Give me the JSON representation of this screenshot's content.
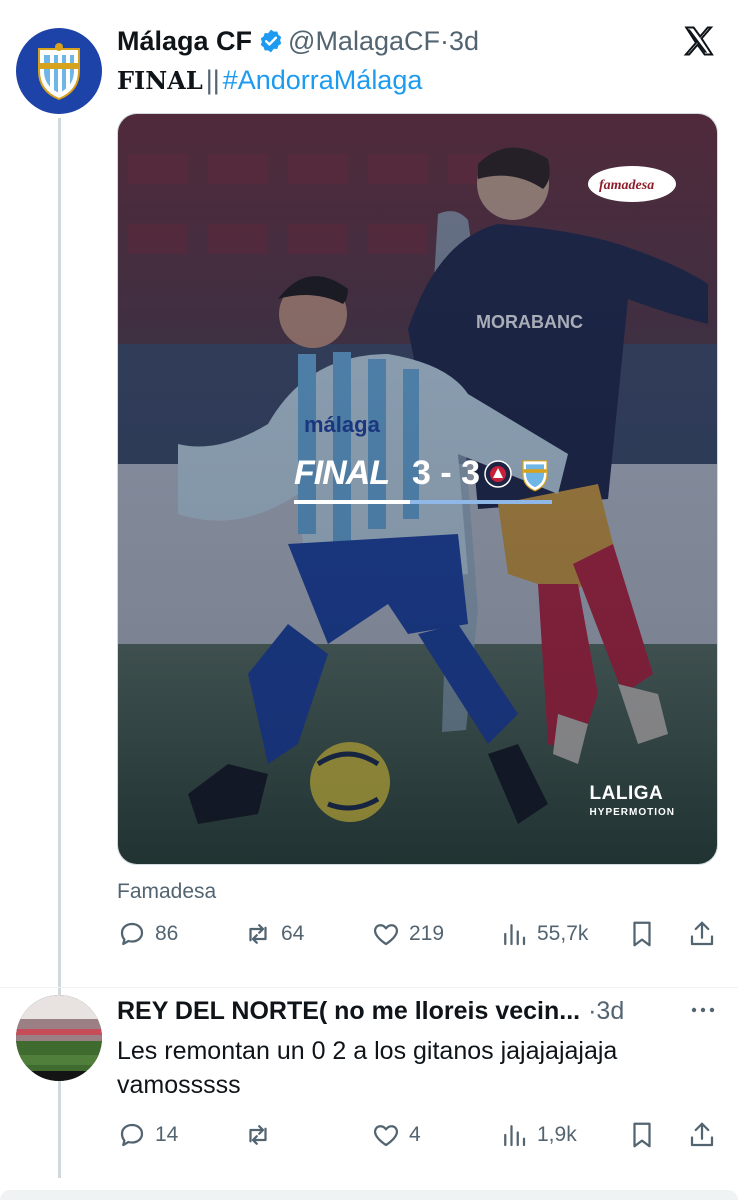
{
  "tweet": {
    "name": "Málaga CF",
    "handle": "@MalagaCF",
    "dot": "·",
    "time": "3d",
    "text_bold": "FINAL",
    "text_sep": "||",
    "hashtag": "#AndorraMálaga",
    "image": {
      "score_label": "FINAL",
      "score": "3 - 3",
      "sponsor_logo": "famadesa",
      "league_line1": "LALIGA",
      "league_line2": "HYPERMOTION"
    },
    "attribution": "Famadesa",
    "actions": {
      "replies": "86",
      "reposts": "64",
      "likes": "219",
      "views": "55,7k"
    }
  },
  "reply": {
    "name": "REY DEL NORTE( no me lloreis vecin...",
    "dot": "·",
    "time": "3d",
    "text": "Les remontan un 0 2 a los gitanos jajajajajaja vamosssss",
    "actions": {
      "replies": "14",
      "reposts": "",
      "likes": "4",
      "views": "1,9k"
    }
  },
  "colors": {
    "link": "#1d9bf0",
    "muted": "#536471",
    "text": "#0f1419",
    "club_blue": "#1d43a8"
  }
}
